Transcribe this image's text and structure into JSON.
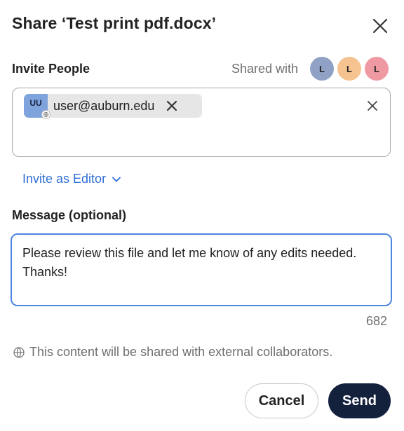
{
  "dialog": {
    "title": "Share ‘Test print pdf.docx’"
  },
  "invite": {
    "label": "Invite People",
    "shared_with_label": "Shared with",
    "shared_avatars": [
      {
        "initial": "L",
        "color": "#8fa2c6"
      },
      {
        "initial": "L",
        "color": "#f4c38f"
      },
      {
        "initial": "L",
        "color": "#ef9aa3"
      }
    ],
    "recipients": [
      {
        "initials": "UU",
        "email": "user@auburn.edu",
        "avatar_color": "#7fa4dd"
      }
    ],
    "role_label": "Invite as Editor"
  },
  "message": {
    "label": "Message (optional)",
    "value": "Please review this file and let me know of any edits needed. Thanks!",
    "remaining_chars": "682"
  },
  "notice": {
    "icon": "globe-icon",
    "text": "This content will be shared with external collaborators."
  },
  "actions": {
    "cancel_label": "Cancel",
    "send_label": "Send"
  },
  "colors": {
    "accent": "#4c86e0",
    "link": "#2f6fd6",
    "primary_button": "#14213d"
  }
}
